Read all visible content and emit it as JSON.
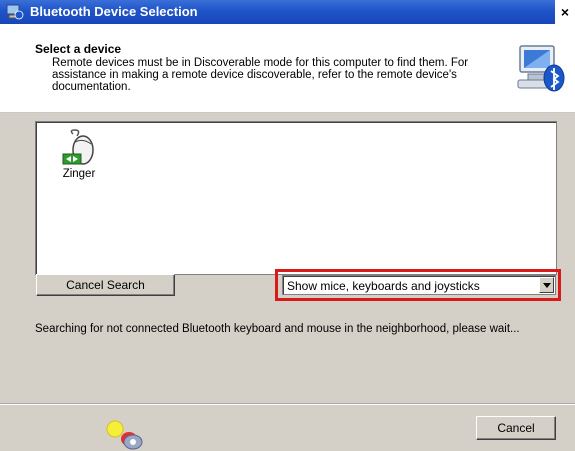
{
  "window": {
    "title": "Bluetooth Device Selection",
    "close_label": "×"
  },
  "header": {
    "title": "Select a device",
    "description": "Remote devices must be in Discoverable mode for this computer to find them. For assistance in making a remote device discoverable, refer to the remote device's documentation."
  },
  "devices": [
    {
      "label": "Zinger",
      "icon": "bluetooth-mouse-icon"
    }
  ],
  "buttons": {
    "cancel_search": "Cancel Search",
    "cancel": "Cancel"
  },
  "filter": {
    "selected": "Show mice, keyboards and joysticks"
  },
  "status": {
    "text": "Searching for not connected Bluetooth keyboard and mouse in the neighborhood, please wait..."
  },
  "colors": {
    "titlebar": "#1f54c9",
    "highlight": "#d81a1a",
    "dialog_bg": "#d4d0c8"
  }
}
